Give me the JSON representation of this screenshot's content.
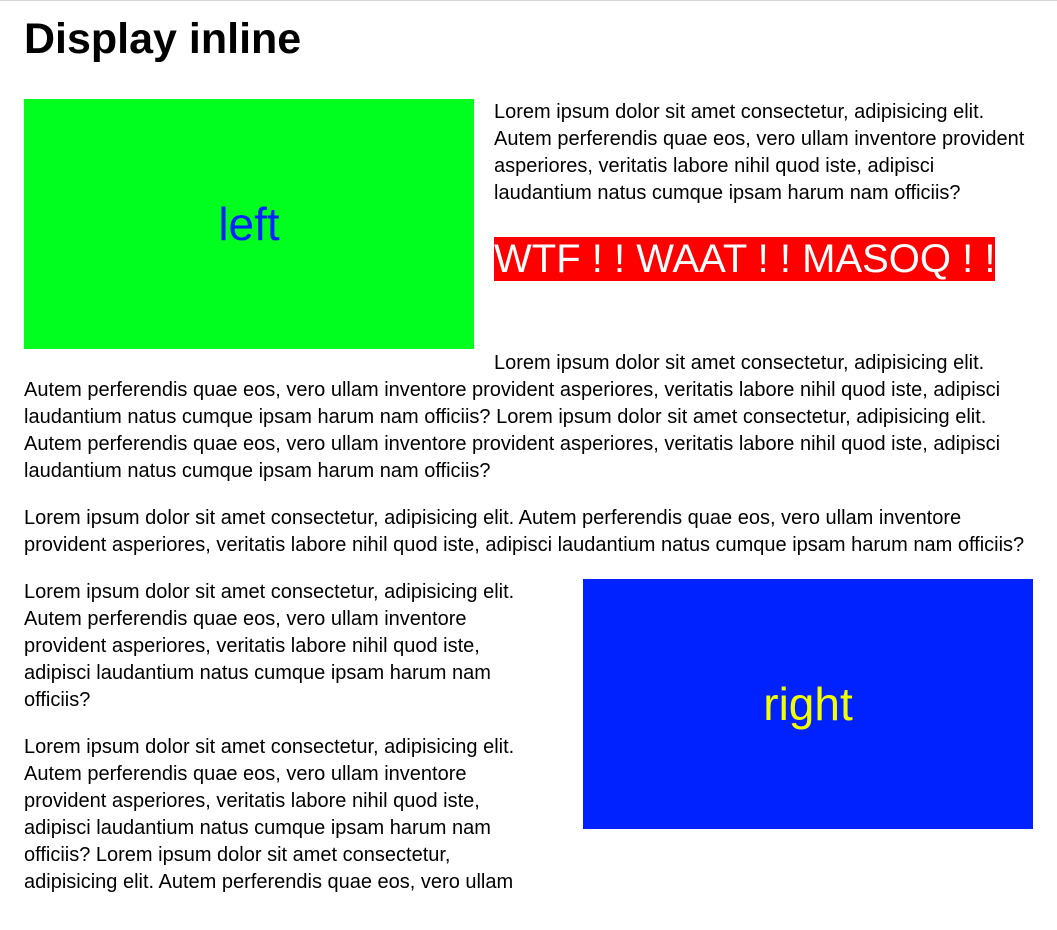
{
  "heading": "Display inline",
  "boxes": {
    "left": {
      "label": "left",
      "bg_color": "#00ff1e",
      "text_color": "#0022ff"
    },
    "right": {
      "label": "right",
      "bg_color": "#0022ff",
      "text_color": "#f2ff00"
    }
  },
  "warning_text": "WTF ! ! WAAT ! ! MASOQ ! !",
  "paragraphs": {
    "p1": "Lorem ipsum dolor sit amet consectetur, adipisicing elit. Autem perferendis quae eos, vero ullam inventore provident asperiores, veritatis labore nihil quod iste, adipisci laudantium natus cumque ipsam harum nam officiis?",
    "p2": "Lorem ipsum dolor sit amet consectetur, adipisicing elit. Autem perferendis quae eos, vero ullam inventore provident asperiores, veritatis labore nihil quod iste, adipisci laudantium natus cumque ipsam harum nam officiis? Lorem ipsum dolor sit amet consectetur, adipisicing elit. Autem perferendis quae eos, vero ullam inventore provident asperiores, veritatis labore nihil quod iste, adipisci laudantium natus cumque ipsam harum nam officiis?",
    "p3": "Lorem ipsum dolor sit amet consectetur, adipisicing elit. Autem perferendis quae eos, vero ullam inventore provident asperiores, veritatis labore nihil quod iste, adipisci laudantium natus cumque ipsam harum nam officiis?",
    "p4": "Lorem ipsum dolor sit amet consectetur, adipisicing elit. Autem perferendis quae eos, vero ullam inventore provident asperiores, veritatis labore nihil quod iste, adipisci laudantium natus cumque ipsam harum nam officiis?",
    "p5": "Lorem ipsum dolor sit amet consectetur, adipisicing elit. Autem perferendis quae eos, vero ullam inventore provident asperiores, veritatis labore nihil quod iste, adipisci laudantium natus cumque ipsam harum nam officiis? Lorem ipsum dolor sit amet consectetur, adipisicing elit. Autem perferendis quae eos, vero ullam"
  }
}
